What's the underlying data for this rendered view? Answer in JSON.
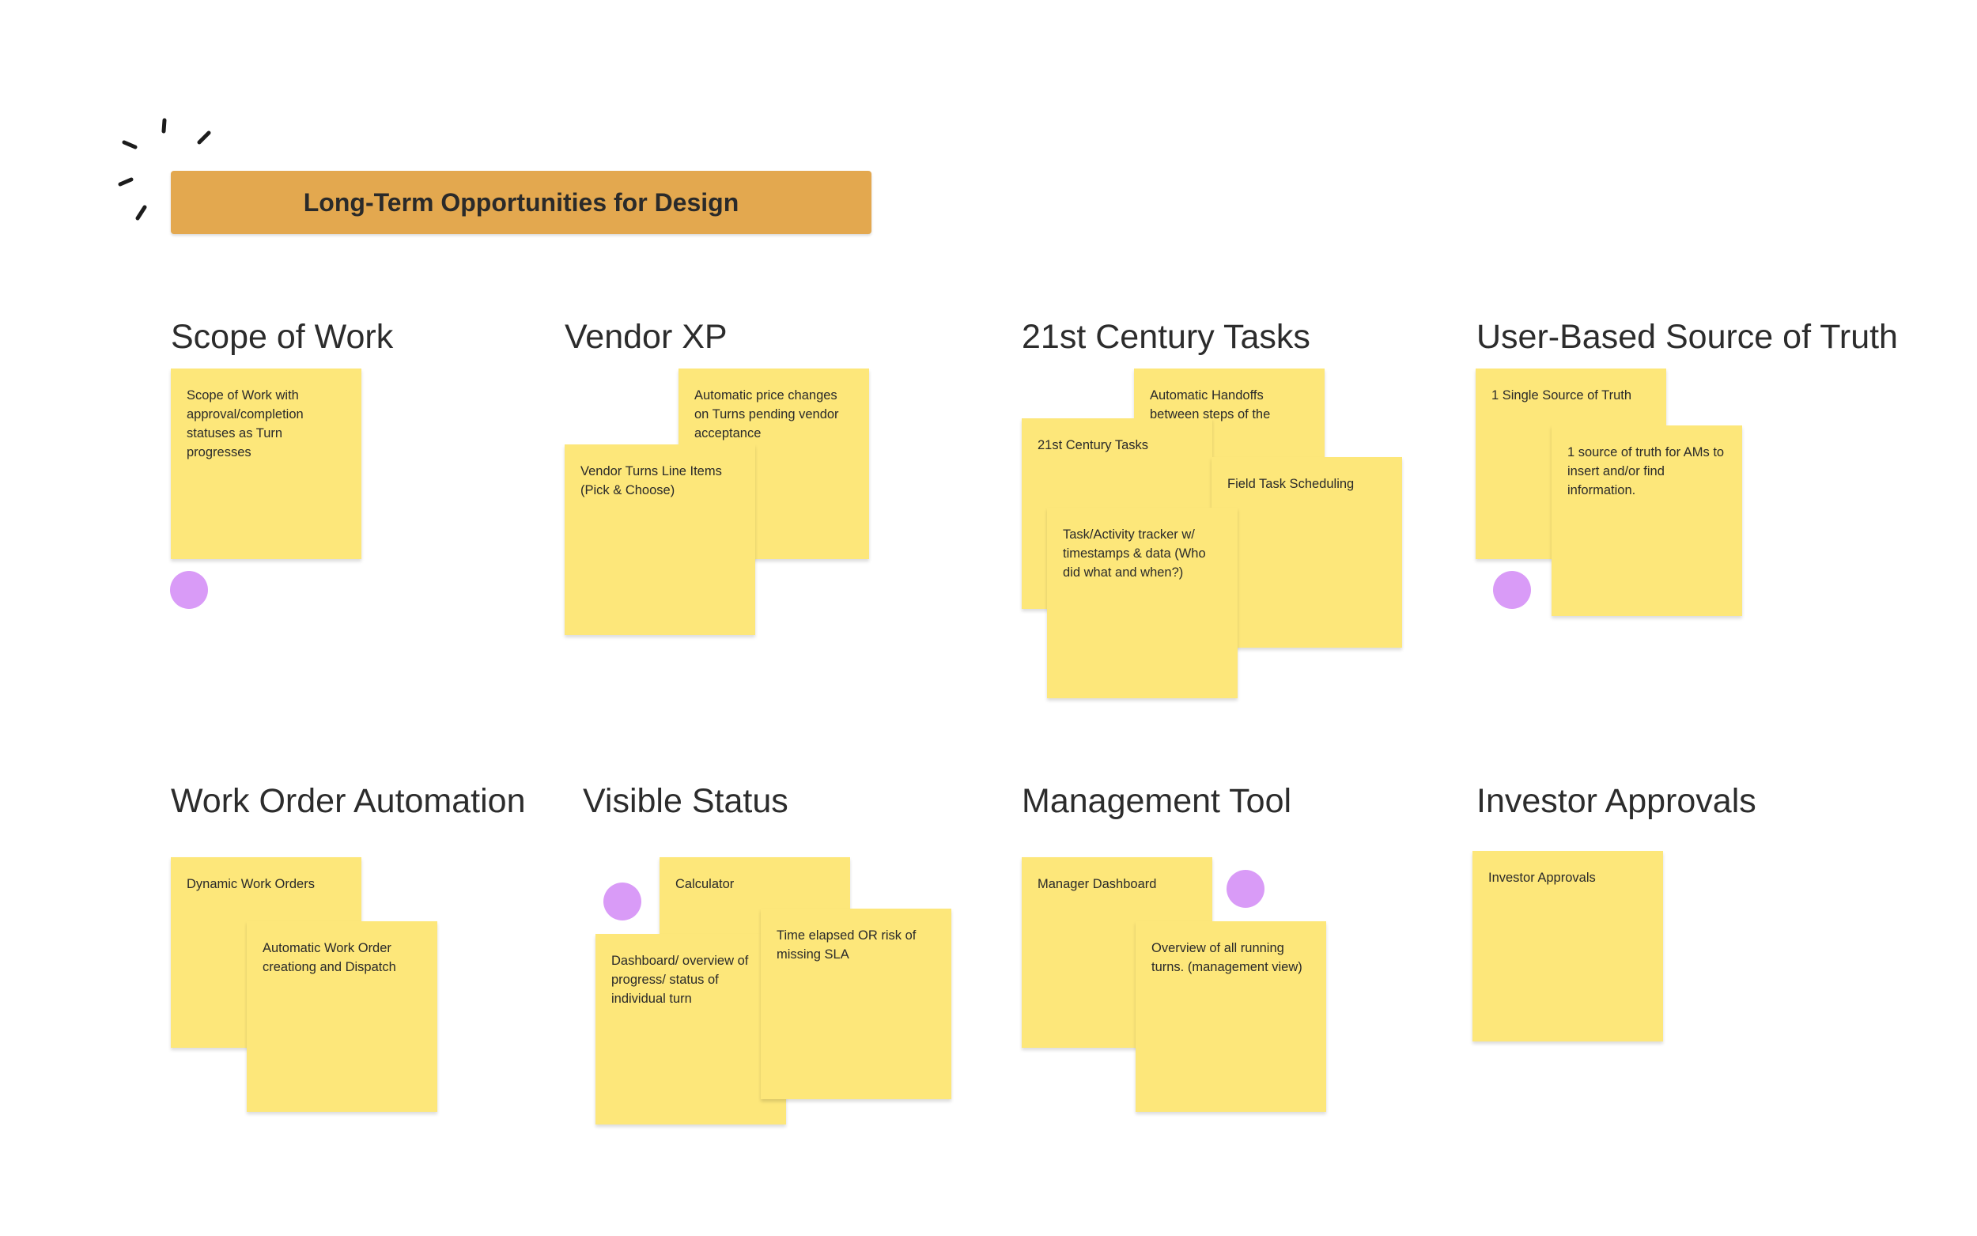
{
  "board": {
    "banner_title": "Long-Term Opportunities for Design",
    "colors": {
      "banner": "#e3a84f",
      "sticky": "#fde77a",
      "dot": "#d99bf7",
      "text": "#2b2b2b"
    },
    "icons": {
      "sparkle": "sparkle-accent-icon"
    }
  },
  "sections": {
    "scope_of_work": {
      "title": "Scope of Work",
      "stickies": [
        "Scope of Work with approval/completion statuses as Turn progresses"
      ]
    },
    "vendor_xp": {
      "title": "Vendor XP",
      "stickies": [
        "Automatic price changes on Turns pending vendor acceptance",
        "Vendor Turns Line Items (Pick & Choose)"
      ]
    },
    "century_tasks": {
      "title": "21st Century Tasks",
      "stickies": [
        "Automatic Handoffs between steps of the",
        "21st Century Tasks",
        "Field Task Scheduling",
        "Task/Activity tracker w/ timestamps & data (Who did what and when?)"
      ]
    },
    "source_of_truth": {
      "title": "User-Based Source of Truth",
      "stickies": [
        "1 Single Source of Truth",
        "1 source of truth for AMs to insert and/or find information."
      ]
    },
    "work_order_automation": {
      "title": "Work Order Automation",
      "stickies": [
        "Dynamic Work Orders",
        "Automatic Work Order creationg and Dispatch"
      ]
    },
    "visible_status": {
      "title": "Visible Status",
      "stickies": [
        "Calculator",
        "Dashboard/ overview of progress/ status of individual turn",
        "Time elapsed OR risk of missing SLA"
      ]
    },
    "management_tool": {
      "title": "Management Tool",
      "stickies": [
        "Manager Dashboard",
        "Overview of all running turns.  (management view)"
      ]
    },
    "investor_approvals": {
      "title": "Investor Approvals",
      "stickies": [
        "Investor  Approvals"
      ]
    }
  }
}
